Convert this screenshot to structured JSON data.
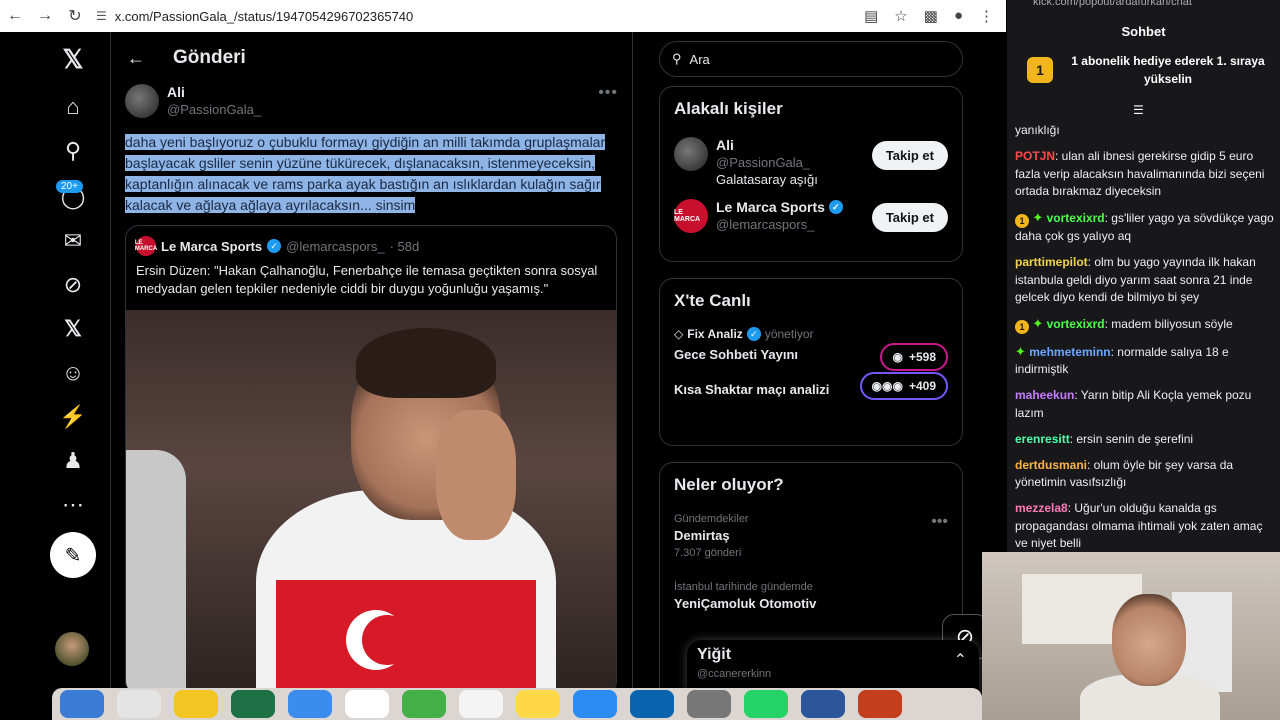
{
  "browser": {
    "url": "x.com/PassionGala_/status/1947054296702365740"
  },
  "nav": {
    "notifications_badge": "20+"
  },
  "header": {
    "title": "Gönderi"
  },
  "tweet": {
    "author_name": "Ali",
    "author_handle": "@PassionGala_",
    "text": "daha yeni başlıyoruz o çubuklu formayı giydiğin an milli takımda gruplaşmalar başlayacak gsliler senin yüzüne tükürecek, dışlanacaksın, istenmeyeceksin, kaptanlığın alınacak ve  rams parka ayak bastığın an ıslıklardan kulağın sağır kalacak ve ağlaya ağlaya ayrılacaksın... sinsim"
  },
  "quote": {
    "logo": "LE MARCA",
    "name": "Le Marca Sports",
    "handle": "@lemarcaspors_",
    "time": "· 58d",
    "text": "Ersin Düzen: \"Hakan Çalhanoğlu, Fenerbahçe ile temasa geçtikten sonra sosyal medyadan gelen tepkiler nedeniyle ciddi bir duygu yoğunluğu yaşamış.\""
  },
  "search": {
    "placeholder": "Ara"
  },
  "related": {
    "title": "Alakalı kişiler",
    "people": [
      {
        "name": "Ali",
        "handle": "@PassionGala_",
        "bio": "Galatasaray aşığı",
        "button": "Takip et"
      },
      {
        "name": "Le Marca Sports",
        "handle": "@lemarcaspors_",
        "bio": "",
        "button": "Takip et",
        "logo": "LE MARCA"
      }
    ]
  },
  "live": {
    "title": "X'te Canlı",
    "items": [
      {
        "host": "Fix Analiz",
        "role": "yönetiyor",
        "title": "Gece Sohbeti Yayını",
        "count": "+598"
      },
      {
        "host": "",
        "role": "",
        "title": "Kısa Shaktar maçı analizi",
        "count": "+409"
      }
    ]
  },
  "trends": {
    "title": "Neler oluyor?",
    "items": [
      {
        "meta": "Gündemdekiler",
        "name": "Demirtaş",
        "count": "7.307 gönderi"
      },
      {
        "meta": "İstanbul tarihinde gündemde",
        "name": "YeniÇamoluk Otomotiv",
        "count": ""
      }
    ]
  },
  "dm": {
    "name": "Yiğit",
    "handle": "@ccanererkinn"
  },
  "chat": {
    "url": "kick.com/popout/ardafurkan/chat",
    "title": "Sohbet",
    "gift_badge": "1",
    "gift_text": "1 abonelik hediye ederek 1. sıraya yükselin",
    "messages": [
      {
        "user": "",
        "text": "yanıklığı",
        "color": "#efeff1",
        "badges": false
      },
      {
        "user": "POTJN",
        "text": ": ulan ali ibnesi gerekirse gidip 5 euro fazla verip alacaksın havalimanında bizi seçeni ortada bırakmaz diyeceksin",
        "color": "#ff4a4a",
        "badges": false
      },
      {
        "user": "vortexixrd",
        "text": ": gs'liler yago ya sövdükçe yago daha çok gs yalıyo aq",
        "color": "#4dff4d",
        "badges": true
      },
      {
        "user": "parttimepilot",
        "text": ": olm bu yago yayında ilk hakan istanbula geldi diyo yarım saat sonra 21 inde gelcek diyo kendi de bilmiyo bi şey",
        "color": "#f0d44a",
        "badges": false
      },
      {
        "user": "vortexixrd",
        "text": ": madem biliyosun söyle",
        "color": "#4dff4d",
        "badges": true
      },
      {
        "user": "mehmeteminn",
        "text": ": normalde salıya 18 e indirmiştik",
        "color": "#6aa8ff",
        "badges": "green"
      },
      {
        "user": "maheekun",
        "text": ": Yarın bitip Ali Koçla yemek pozu lazım",
        "color": "#c77dff",
        "badges": false
      },
      {
        "user": "erenresitt",
        "text": ": ersin senin de şerefini",
        "color": "#4dffa8",
        "badges": false
      },
      {
        "user": "dertdusmani",
        "text": ": olum öyle bir şey varsa da yönetimin vasıfsızlığı",
        "color": "#ffb347",
        "badges": false
      },
      {
        "user": "mezzela8",
        "text": ": Uğur'un olduğu kanalda gs propagandası olmama ihtimali yok zaten amaç ve niyet belli",
        "color": "#ff7ab6",
        "badges": false
      }
    ]
  },
  "colors": {
    "accent": "#1d9bf0",
    "selection": "#8fb4e6",
    "kick_green": "#53fc18"
  }
}
